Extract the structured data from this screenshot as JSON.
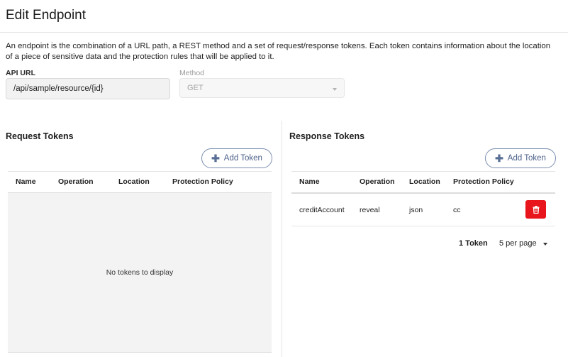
{
  "page": {
    "title": "Edit Endpoint",
    "description": "An endpoint is the combination of a URL path, a REST method and a set of request/response tokens. Each token contains information about the location of a piece of sensitive data and the protection rules that will be applied to it."
  },
  "form": {
    "api_url_label": "API URL",
    "api_url_value": "/api/sample/resource/{id}",
    "method_label": "Method",
    "method_value": "GET"
  },
  "request_tokens": {
    "title": "Request Tokens",
    "add_label": "Add Token",
    "columns": [
      "Name",
      "Operation",
      "Location",
      "Protection Policy"
    ],
    "empty_text": "No tokens to display"
  },
  "response_tokens": {
    "title": "Response Tokens",
    "add_label": "Add Token",
    "columns": [
      "Name",
      "Operation",
      "Location",
      "Protection Policy"
    ],
    "rows": [
      {
        "name": "creditAccount",
        "operation": "reveal",
        "location": "json",
        "policy": "cc"
      }
    ],
    "count_label": "1 Token",
    "per_page_label": "5 per page"
  },
  "colors": {
    "accent": "#4d628a",
    "danger": "#e8161c"
  },
  "icons": {
    "add": "plus-icon",
    "delete": "trash-icon",
    "dropdown": "chevron-down-icon"
  }
}
